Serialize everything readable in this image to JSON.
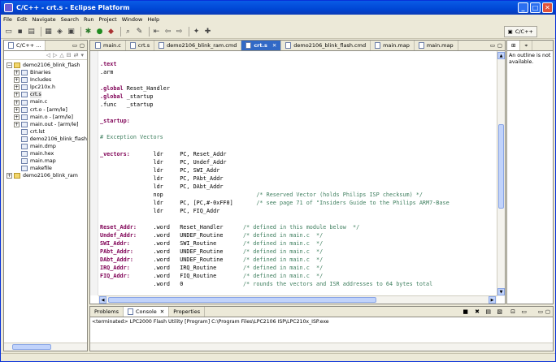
{
  "window": {
    "title": "C/C++ - crt.s - Eclipse Platform"
  },
  "menu": [
    "File",
    "Edit",
    "Navigate",
    "Search",
    "Run",
    "Project",
    "Window",
    "Help"
  ],
  "perspective": {
    "label": "C/C++"
  },
  "project_explorer": {
    "tab_label": "C/C++ ...",
    "items": [
      {
        "indent": 0,
        "expander": "−",
        "label": "demo2106_blink_flash",
        "icon": "project-icon"
      },
      {
        "indent": 1,
        "expander": "+",
        "label": "Binaries",
        "icon": "binaries-icon"
      },
      {
        "indent": 1,
        "expander": "+",
        "label": "Includes",
        "icon": "includes-icon"
      },
      {
        "indent": 1,
        "expander": "+",
        "label": "lpc210x.h",
        "icon": "header-file-icon"
      },
      {
        "indent": 1,
        "expander": "+",
        "label": "crt.s",
        "icon": "asm-file-icon"
      },
      {
        "indent": 1,
        "expander": "+",
        "label": "main.c",
        "icon": "c-file-icon"
      },
      {
        "indent": 1,
        "expander": "+",
        "label": "crt.o - [arm/le]",
        "icon": "object-file-icon"
      },
      {
        "indent": 1,
        "expander": "+",
        "label": "main.o - [arm/le]",
        "icon": "object-file-icon"
      },
      {
        "indent": 1,
        "expander": "+",
        "label": "main.out - [arm/le]",
        "icon": "binary-icon"
      },
      {
        "indent": 1,
        "expander": "",
        "label": "crt.lst",
        "icon": "file-icon"
      },
      {
        "indent": 1,
        "expander": "",
        "label": "demo2106_blink_flash",
        "icon": "file-icon"
      },
      {
        "indent": 1,
        "expander": "",
        "label": "main.dmp",
        "icon": "file-icon"
      },
      {
        "indent": 1,
        "expander": "",
        "label": "main.hex",
        "icon": "file-icon"
      },
      {
        "indent": 1,
        "expander": "",
        "label": "main.map",
        "icon": "file-icon"
      },
      {
        "indent": 1,
        "expander": "",
        "label": "makefile",
        "icon": "file-icon"
      },
      {
        "indent": 0,
        "expander": "+",
        "label": "demo2106_blink_ram",
        "icon": "project-icon"
      }
    ]
  },
  "editor": {
    "tabs": [
      {
        "label": "main.c",
        "active": false
      },
      {
        "label": "crt.s",
        "active": false
      },
      {
        "label": "demo2106_blink_ram.cmd",
        "active": false
      },
      {
        "label": "crt.s",
        "active": true
      },
      {
        "label": "demo2106_blink_flash.cmd",
        "active": false
      },
      {
        "label": "main.map",
        "active": false
      },
      {
        "label": "main.map",
        "active": false
      }
    ],
    "lines": [
      {
        "l": "",
        "m": "",
        "r": ""
      },
      {
        "l": ".text",
        "m": "",
        "r": "",
        "lk": true
      },
      {
        "l": ".arm",
        "m": "",
        "r": ""
      },
      {
        "l": "",
        "m": "",
        "r": ""
      },
      {
        "l": ".global",
        "m": " Reset_Handler",
        "r": "",
        "lk": true
      },
      {
        "l": ".global",
        "m": " _startup",
        "r": "",
        "lk": true
      },
      {
        "l": ".func",
        "m": "   _startup",
        "r": ""
      },
      {
        "l": "",
        "m": "",
        "r": ""
      },
      {
        "l": "_startup:",
        "m": "",
        "r": "",
        "lk": true
      },
      {
        "l": "",
        "m": "",
        "r": ""
      },
      {
        "l": "# Exception Vectors",
        "m": "",
        "r": "",
        "lc": true
      },
      {
        "l": "",
        "m": "",
        "r": ""
      },
      {
        "l": "_vectors:",
        "m": "       ldr     PC, Reset_Addr",
        "r": "",
        "lk": true
      },
      {
        "l": "",
        "m": "                ldr     PC, Undef_Addr",
        "r": ""
      },
      {
        "l": "",
        "m": "                ldr     PC, SWI_Addr",
        "r": ""
      },
      {
        "l": "",
        "m": "                ldr     PC, PAbt_Addr",
        "r": ""
      },
      {
        "l": "",
        "m": "                ldr     PC, DAbt_Addr",
        "r": ""
      },
      {
        "l": "",
        "m": "                nop                            ",
        "r": "/* Reserved Vector (holds Philips ISP checksum) */"
      },
      {
        "l": "",
        "m": "                ldr     PC, [PC,#-0xFF0]       ",
        "r": "/* see page 71 of \"Insiders Guide to the Philips ARM7-Base"
      },
      {
        "l": "",
        "m": "                ldr     PC, FIQ_Addr",
        "r": ""
      },
      {
        "l": "",
        "m": "",
        "r": ""
      },
      {
        "l": "Reset_Addr:",
        "m": "     .word   Reset_Handler      ",
        "r": "/* defined in this module below  */",
        "lk": true
      },
      {
        "l": "Undef_Addr:",
        "m": "     .word   UNDEF_Routine      ",
        "r": "/* defined in main.c  */",
        "lk": true
      },
      {
        "l": "SWI_Addr:",
        "m": "       .word   SWI_Routine        ",
        "r": "/* defined in main.c  */",
        "lk": true
      },
      {
        "l": "PAbt_Addr:",
        "m": "      .word   UNDEF_Routine      ",
        "r": "/* defined in main.c  */",
        "lk": true
      },
      {
        "l": "DAbt_Addr:",
        "m": "      .word   UNDEF_Routine      ",
        "r": "/* defined in main.c  */",
        "lk": true
      },
      {
        "l": "IRQ_Addr:",
        "m": "       .word   IRQ_Routine        ",
        "r": "/* defined in main.c  */",
        "lk": true
      },
      {
        "l": "FIQ_Addr:",
        "m": "       .word   FIQ_Routine        ",
        "r": "/* defined in main.c  */",
        "lk": true
      },
      {
        "l": "",
        "m": "                .word   0                  ",
        "r": "/* rounds the vectors and ISR addresses to 64 bytes total"
      }
    ]
  },
  "outline": {
    "message": "An outline is not available."
  },
  "bottom": {
    "tabs": [
      {
        "label": "Problems",
        "active": false
      },
      {
        "label": "Console",
        "active": true
      },
      {
        "label": "Properties",
        "active": false
      }
    ],
    "console_text": "<terminated> LPC2000 Flash Utility [Program] C:\\Program Files\\LPC2106 ISP\\LPC210x_ISP.exe"
  }
}
